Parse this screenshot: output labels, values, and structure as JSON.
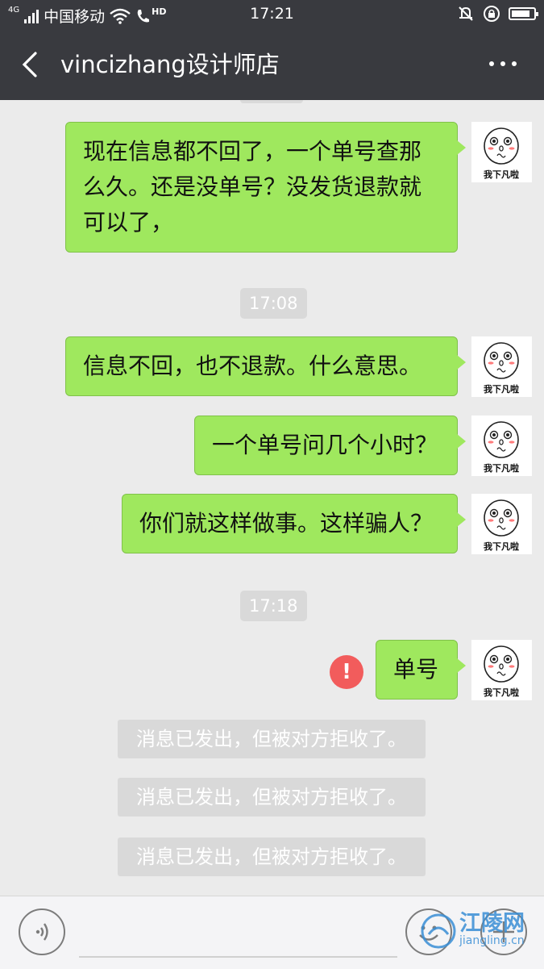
{
  "status_bar": {
    "network": "4G",
    "carrier": "中国移动",
    "hd": "HD",
    "time": "17:21",
    "battery_level": 0.85
  },
  "header": {
    "title": "vincizhang设计师店"
  },
  "avatar_caption": "我下凡啦",
  "messages": [
    {
      "type": "text",
      "text_lines": [
        "现在信息都不回了，一个单号查那",
        "么久。还是没单号？没发货退款就",
        "可以了，"
      ]
    },
    {
      "type": "time",
      "text": "17:08"
    },
    {
      "type": "text",
      "text": "信息不回，也不退款。什么意思。"
    },
    {
      "type": "text",
      "text": "一个单号问几个小时？"
    },
    {
      "type": "text",
      "text": "你们就这样做事。这样骗人？"
    },
    {
      "type": "time",
      "text": "17:18"
    },
    {
      "type": "text",
      "text": "单号",
      "failed": true,
      "error_mark": "!"
    },
    {
      "type": "system",
      "text": "消息已发出，但被对方拒收了。"
    },
    {
      "type": "system",
      "text": "消息已发出，但被对方拒收了。"
    },
    {
      "type": "system",
      "text": "消息已发出，但被对方拒收了。"
    }
  ],
  "watermark": {
    "name": "江陵网",
    "url": "jiangling.cn"
  },
  "colors": {
    "header_bg": "#393a3f",
    "bubble_green": "#9fe85e",
    "chat_bg": "#ebebeb",
    "error_red": "#f25c5c"
  }
}
